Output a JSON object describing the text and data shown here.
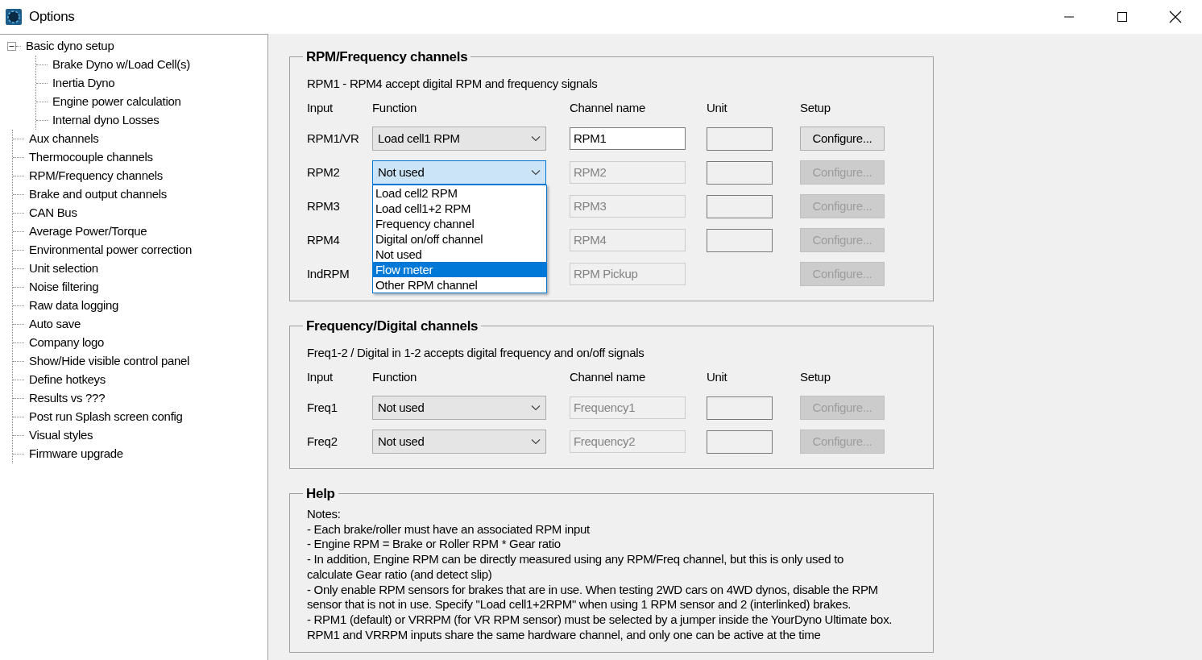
{
  "window": {
    "title": "Options"
  },
  "sidebar": {
    "items": [
      {
        "label": "Basic dyno setup",
        "expanded": true,
        "children": [
          {
            "label": "Brake Dyno w/Load Cell(s)"
          },
          {
            "label": "Inertia Dyno"
          },
          {
            "label": "Engine power calculation"
          },
          {
            "label": "Internal dyno Losses"
          }
        ]
      },
      {
        "label": "Aux channels"
      },
      {
        "label": "Thermocouple channels"
      },
      {
        "label": "RPM/Frequency channels"
      },
      {
        "label": "Brake and output channels"
      },
      {
        "label": "CAN Bus"
      },
      {
        "label": "Average Power/Torque"
      },
      {
        "label": "Environmental power correction"
      },
      {
        "label": "Unit selection"
      },
      {
        "label": "Noise filtering"
      },
      {
        "label": "Raw data logging"
      },
      {
        "label": "Auto save"
      },
      {
        "label": "Company logo"
      },
      {
        "label": "Show/Hide visible control panel"
      },
      {
        "label": "Define hotkeys"
      },
      {
        "label": "Results vs ???"
      },
      {
        "label": "Post run Splash screen config"
      },
      {
        "label": "Visual styles"
      },
      {
        "label": "Firmware upgrade"
      }
    ]
  },
  "groups": [
    {
      "title": "RPM/Frequency channels",
      "description": "RPM1 - RPM4 accept digital RPM and frequency signals",
      "columns": [
        "Input",
        "Function",
        "Channel name",
        "Unit",
        "Setup"
      ],
      "rows": [
        {
          "input": "RPM1/VR",
          "function": "Load cell1 RPM",
          "open": false,
          "channel_name": "RPM1",
          "disabled": false,
          "unit_field": true,
          "setup": "Configure..."
        },
        {
          "input": "RPM2",
          "function": "Not used",
          "open": true,
          "channel_name": "RPM2",
          "disabled": true,
          "unit_field": true,
          "setup": "Configure...",
          "options": [
            {
              "label": "Load cell2 RPM",
              "selected": false
            },
            {
              "label": "Load cell1+2 RPM",
              "selected": false
            },
            {
              "label": "Frequency channel",
              "selected": false
            },
            {
              "label": "Digital on/off channel",
              "selected": false
            },
            {
              "label": "Not used",
              "selected": false
            },
            {
              "label": "Flow meter",
              "selected": true
            },
            {
              "label": "Other RPM channel",
              "selected": false
            }
          ]
        },
        {
          "input": "RPM3",
          "channel_name": "RPM3",
          "disabled": true,
          "unit_field": true,
          "setup": "Configure..."
        },
        {
          "input": "RPM4",
          "channel_name": "RPM4",
          "disabled": true,
          "unit_field": true,
          "setup": "Configure..."
        },
        {
          "input": "IndRPM",
          "channel_name": "RPM Pickup",
          "disabled": true,
          "unit_field": false,
          "setup": "Configure..."
        }
      ]
    },
    {
      "title": "Frequency/Digital channels",
      "description": "Freq1-2 / Digital in 1-2 accepts digital frequency and on/off signals",
      "columns": [
        "Input",
        "Function",
        "Channel name",
        "Unit",
        "Setup"
      ],
      "rows": [
        {
          "input": "Freq1",
          "function": "Not used",
          "open": false,
          "channel_name": "Frequency1",
          "disabled": true,
          "unit_field": true,
          "setup": "Configure..."
        },
        {
          "input": "Freq2",
          "function": "Not used",
          "open": false,
          "channel_name": "Frequency2",
          "disabled": true,
          "unit_field": true,
          "setup": "Configure..."
        }
      ]
    }
  ],
  "help": {
    "title": "Help",
    "lines": [
      "Notes:",
      "- Each brake/roller must have an associated RPM input",
      "- Engine RPM = Brake or Roller RPM * Gear ratio",
      "- In addition, Engine RPM can be directly measured using any RPM/Freq channel, but this is only used to",
      "calculate Gear ratio (and detect slip)",
      "- Only enable RPM sensors for brakes that are in use. When testing 2WD cars on 4WD dynos, disable the RPM",
      "sensor that is not in use. Specify \"Load cell1+2RPM\" when using 1 RPM sensor and 2 (interlinked) brakes.",
      "- RPM1 (default) or VRRPM (for VR RPM sensor) must be selected by a jumper inside the YourDyno Ultimate box.",
      "RPM1 and VRRPM inputs share the same hardware channel, and only one can be active at the time"
    ]
  }
}
